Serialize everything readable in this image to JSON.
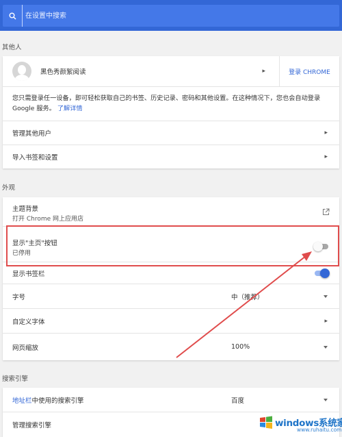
{
  "search": {
    "placeholder": "在设置中搜索"
  },
  "people": {
    "section_title": "其他人",
    "profile_name": "黑色秀颜絮阅读",
    "signin_label": "登录 CHROME",
    "description_text": "您只需登录任一设备，即可轻松获取自己的书签、历史记录、密码和其他设置。在这种情况下，您也会自动登录 Google 服务。",
    "learn_more": "了解详情",
    "manage_users": "管理其他用户",
    "import_bookmarks": "导入书签和设置"
  },
  "appearance": {
    "section_title": "外观",
    "theme_title": "主题背景",
    "theme_subtitle": "打开 Chrome 网上应用店",
    "home_button_title": "显示\"主页\"按钮",
    "home_button_status": "已停用",
    "home_button_enabled": false,
    "bookmarks_bar_label": "显示书签栏",
    "bookmarks_bar_enabled": true,
    "font_size_label": "字号",
    "font_size_value": "中（推荐）",
    "custom_fonts_label": "自定义字体",
    "page_zoom_label": "网页缩放",
    "page_zoom_value": "100%"
  },
  "search_engine": {
    "section_title": "搜索引擎",
    "address_bar_link": "地址栏",
    "address_bar_suffix": "中使用的搜索引擎",
    "engine_value": "百度",
    "manage_label": "管理搜索引擎"
  },
  "watermark": {
    "brand": "windows系统家园",
    "url": "www.ruhaitu.com"
  },
  "colors": {
    "accent": "#3367d6",
    "annotation": "#e04c4c"
  }
}
